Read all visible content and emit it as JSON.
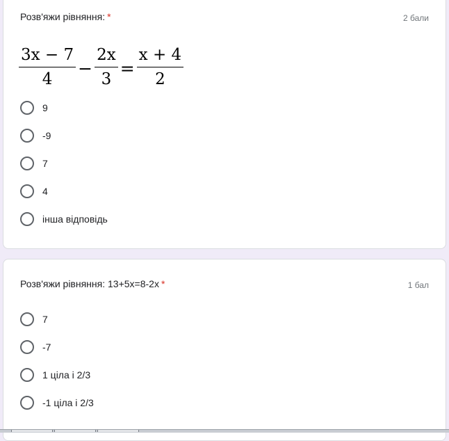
{
  "question1": {
    "title": "Розв'яжи рівняння:",
    "required_mark": "*",
    "points": "2 бали",
    "equation": {
      "left_fraction": {
        "numerator": "3x − 7",
        "denominator": "4"
      },
      "minus": "−",
      "middle_fraction": {
        "numerator": "2x",
        "denominator": "3"
      },
      "equals": "=",
      "right_fraction": {
        "numerator": "x + 4",
        "denominator": "2"
      }
    },
    "options": [
      "9",
      "-9",
      "7",
      "4",
      "інша відповідь"
    ]
  },
  "question2": {
    "title": "Розв'яжи рівняння: 13+5x=8-2x",
    "required_mark": "*",
    "points": "1 бал",
    "options": [
      "7",
      "-7",
      "1 ціла і 2/3",
      "-1 ціла і 2/3"
    ]
  },
  "colors": {
    "background": "#f0ebf8",
    "card": "#ffffff",
    "required": "#d93025",
    "points": "#70757a",
    "radio_border": "#5f6368"
  }
}
